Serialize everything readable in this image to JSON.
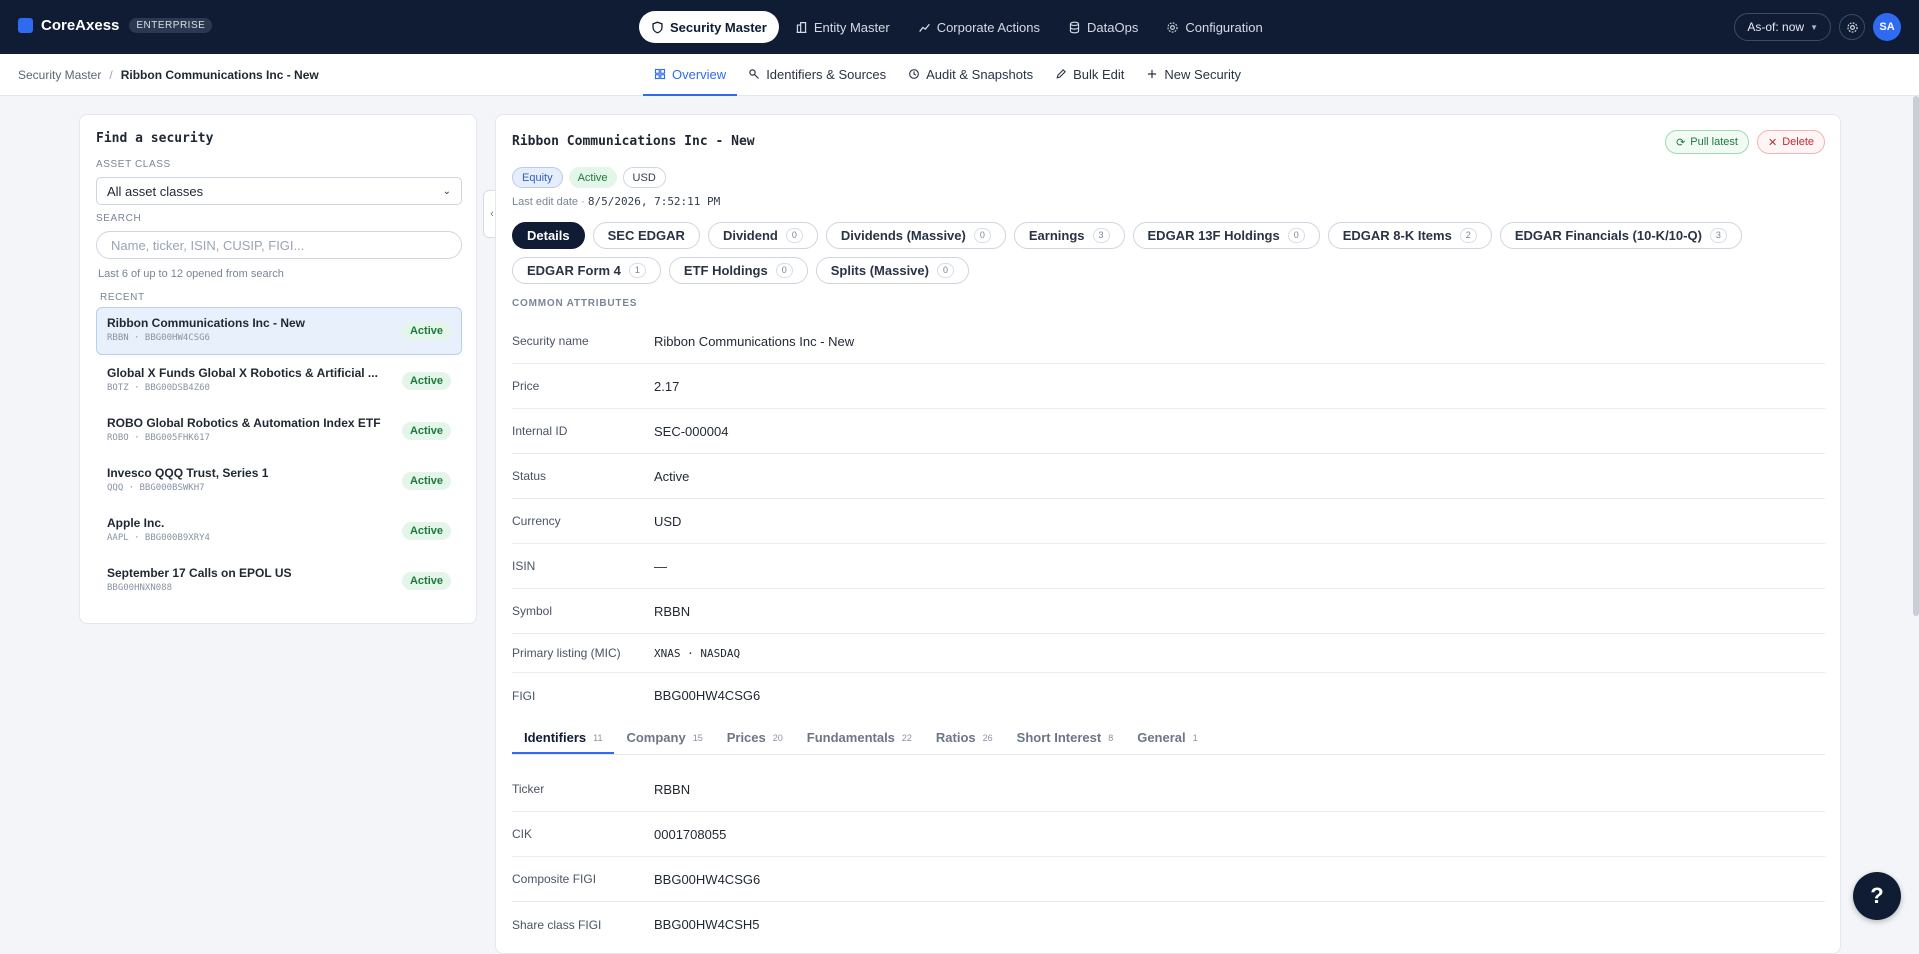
{
  "brand": {
    "name": "CoreAxess",
    "badge": "ENTERPRISE"
  },
  "topnav": [
    {
      "label": "Security Master",
      "icon": "shield-icon",
      "active": true
    },
    {
      "label": "Entity Master",
      "icon": "building-icon"
    },
    {
      "label": "Corporate Actions",
      "icon": "chart-line-icon"
    },
    {
      "label": "DataOps",
      "icon": "database-icon"
    },
    {
      "label": "Configuration",
      "icon": "gear-icon"
    }
  ],
  "topright": {
    "asof_label": "As-of: now",
    "avatar": "SA"
  },
  "breadcrumb": {
    "root": "Security Master",
    "separator": "/",
    "current": "Ribbon Communications Inc - New"
  },
  "subnav": [
    {
      "label": "Overview",
      "icon": "grid-icon",
      "active": true
    },
    {
      "label": "Identifiers & Sources",
      "icon": "key-icon"
    },
    {
      "label": "Audit & Snapshots",
      "icon": "history-icon"
    },
    {
      "label": "Bulk Edit",
      "icon": "pencil-icon"
    },
    {
      "label": "New Security",
      "icon": "plus-icon"
    }
  ],
  "finder": {
    "title": "Find a security",
    "asset_class_label": "ASSET CLASS",
    "asset_class_value": "All asset classes",
    "search_label": "SEARCH",
    "search_placeholder": "Name, ticker, ISIN, CUSIP, FIGI...",
    "hint": "Last 6 of up to 12 opened from search",
    "recent_label": "RECENT",
    "recent": [
      {
        "name": "Ribbon Communications Inc - New",
        "sub": "RBBN · BBG00HW4CSG6",
        "status": "Active",
        "active": true
      },
      {
        "name": "Global X Funds Global X Robotics & Artificial ...",
        "sub": "BOTZ · BBG00DSB4Z60",
        "status": "Active"
      },
      {
        "name": "ROBO Global Robotics & Automation Index ETF",
        "sub": "ROBO · BBG005FHK617",
        "status": "Active"
      },
      {
        "name": "Invesco QQQ Trust, Series 1",
        "sub": "QQQ · BBG000BSWKH7",
        "status": "Active"
      },
      {
        "name": "Apple Inc.",
        "sub": "AAPL · BBG000B9XRY4",
        "status": "Active"
      },
      {
        "name": "September 17 Calls on EPOL US",
        "sub": "BBG00HNXN088",
        "status": "Active"
      }
    ]
  },
  "security": {
    "title": "Ribbon Communications Inc - New",
    "pull_label": "Pull latest",
    "delete_label": "Delete",
    "chips": {
      "asset": "Equity",
      "status": "Active",
      "currency": "USD"
    },
    "last_edit_label": "Last edit date ·",
    "last_edit_value": "8/5/2026, 7:52:11 PM",
    "tabs": [
      {
        "label": "Details",
        "count": "",
        "active": true
      },
      {
        "label": "SEC EDGAR",
        "count": ""
      },
      {
        "label": "Dividend",
        "count": "0"
      },
      {
        "label": "Dividends (Massive)",
        "count": "0"
      },
      {
        "label": "Earnings",
        "count": "3"
      },
      {
        "label": "EDGAR 13F Holdings",
        "count": "0"
      },
      {
        "label": "EDGAR 8-K Items",
        "count": "2"
      },
      {
        "label": "EDGAR Financials (10-K/10-Q)",
        "count": "3"
      },
      {
        "label": "EDGAR Form 4",
        "count": "1"
      },
      {
        "label": "ETF Holdings",
        "count": "0"
      },
      {
        "label": "Splits (Massive)",
        "count": "0"
      }
    ],
    "common_label": "COMMON ATTRIBUTES",
    "attributes": [
      {
        "label": "Security name",
        "value": "Ribbon Communications Inc - New"
      },
      {
        "label": "Price",
        "value": "2.17"
      },
      {
        "label": "Internal ID",
        "value": "SEC-000004"
      },
      {
        "label": "Status",
        "value": "Active"
      },
      {
        "label": "Currency",
        "value": "USD"
      },
      {
        "label": "ISIN",
        "value": "—"
      },
      {
        "label": "Symbol",
        "value": "RBBN"
      },
      {
        "label": "Primary listing (MIC)",
        "value": "XNAS · NASDAQ",
        "mono": true
      },
      {
        "label": "FIGI",
        "value": "BBG00HW4CSG6"
      }
    ],
    "subtabs": [
      {
        "label": "Identifiers",
        "count": "11",
        "active": true
      },
      {
        "label": "Company",
        "count": "15"
      },
      {
        "label": "Prices",
        "count": "20"
      },
      {
        "label": "Fundamentals",
        "count": "22"
      },
      {
        "label": "Ratios",
        "count": "26"
      },
      {
        "label": "Short Interest",
        "count": "8"
      },
      {
        "label": "General",
        "count": "1"
      }
    ],
    "identifiers": [
      {
        "label": "Ticker",
        "value": "RBBN"
      },
      {
        "label": "CIK",
        "value": "0001708055"
      },
      {
        "label": "Composite FIGI",
        "value": "BBG00HW4CSG6"
      },
      {
        "label": "Share class FIGI",
        "value": "BBG00HW4CSH5"
      }
    ]
  },
  "help": "?"
}
